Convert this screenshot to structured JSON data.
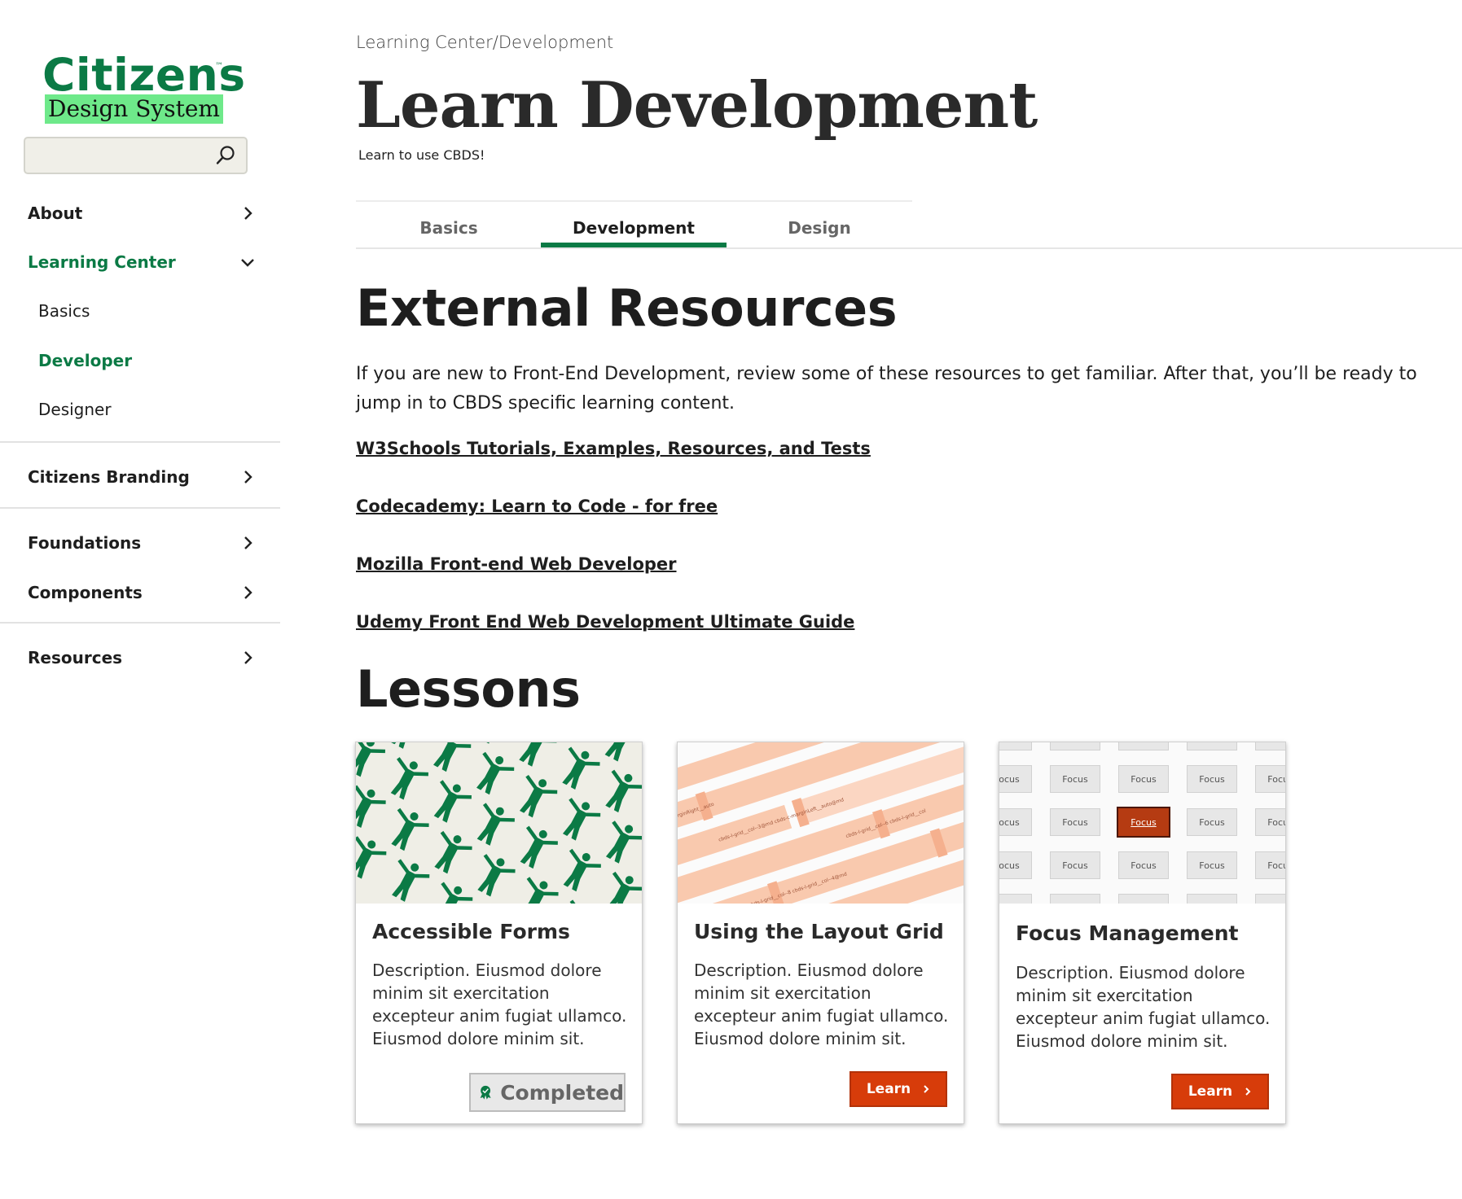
{
  "logo": {
    "word": "Citizens",
    "tm": "™",
    "sub": "Design System"
  },
  "search": {
    "placeholder": ""
  },
  "sidebar": {
    "items": [
      {
        "label": "About"
      },
      {
        "label": "Learning Center",
        "sub": [
          "Basics",
          "Developer",
          "Designer"
        ]
      },
      {
        "label": "Citizens Branding"
      },
      {
        "label": "Foundations"
      },
      {
        "label": "Components"
      },
      {
        "label": "Resources"
      }
    ]
  },
  "header": {
    "breadcrumb": "Learning Center/Development",
    "title": "Learn Development",
    "subtitle": "Learn to use CBDS!"
  },
  "tabs": [
    {
      "label": "Basics"
    },
    {
      "label": "Development",
      "active": true
    },
    {
      "label": "Design"
    }
  ],
  "external": {
    "heading": "External Resources",
    "intro": "If you are new to Front-End Development, review some of these resources to get familiar. After that, you’ll be ready to jump in to CBDS specific learning content.",
    "links": [
      "W3Schools Tutorials, Examples, Resources, and Tests",
      "Codecademy: Learn to Code - for free",
      "Mozilla Front-end Web Developer",
      "Udemy Front End Web Development Ultimate Guide"
    ]
  },
  "lessons": {
    "heading": "Lessons",
    "cards": [
      {
        "title": "Accessible Forms",
        "desc": "Description. Eiusmod dolore minim sit exercitation excepteur anim fugiat ullamco. Eiusmod dolore minim sit.",
        "status": "Completed"
      },
      {
        "title": "Using the Layout Grid",
        "desc": "Description. Eiusmod dolore minim sit exercitation excepteur anim fugiat ullamco. Eiusmod dolore minim sit.",
        "button": "Learn"
      },
      {
        "title": "Focus Management",
        "desc": "Description. Eiusmod dolore minim sit exercitation excepteur anim fugiat ullamco. Eiusmod dolore minim sit.",
        "button": "Learn"
      }
    ],
    "focus_cell_label": "Focus",
    "grid_labels": [
      "cbds-l-grid__col--3@md cbds-c-marginLeft__auto@md",
      "cbds-l-grid__col--6 cbds-l-grid__col",
      "cbds-c-marginRight__auto",
      "cbds-l-grid__col--8 cbds-l-grid__col--4@md"
    ]
  },
  "colors": {
    "brand_green": "#0b7a45",
    "highlight_green": "#6ee98a",
    "cta_orange": "#d73c0a",
    "grid_peach": "#f9c9ae"
  },
  "icons": [
    "search-icon",
    "chevron-right-icon",
    "chevron-down-icon",
    "award-ribbon-icon"
  ]
}
